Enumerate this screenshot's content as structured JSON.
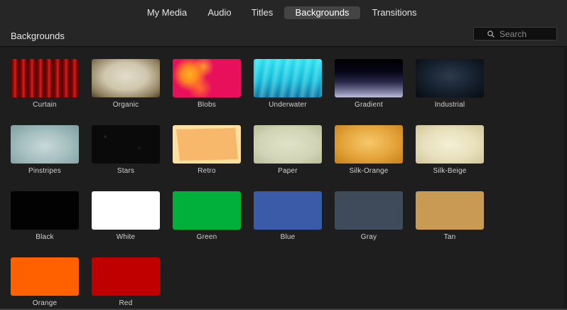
{
  "tabs": [
    {
      "label": "My Media",
      "active": false
    },
    {
      "label": "Audio",
      "active": false
    },
    {
      "label": "Titles",
      "active": false
    },
    {
      "label": "Backgrounds",
      "active": true
    },
    {
      "label": "Transitions",
      "active": false
    }
  ],
  "header": {
    "title": "Backgrounds",
    "search": {
      "placeholder": "Search",
      "value": "",
      "icon": "search-icon"
    }
  },
  "backgrounds": [
    {
      "label": "Curtain"
    },
    {
      "label": "Organic"
    },
    {
      "label": "Blobs"
    },
    {
      "label": "Underwater"
    },
    {
      "label": "Gradient"
    },
    {
      "label": "Industrial"
    },
    {
      "label": "Pinstripes"
    },
    {
      "label": "Stars"
    },
    {
      "label": "Retro"
    },
    {
      "label": "Paper"
    },
    {
      "label": "Silk-Orange"
    },
    {
      "label": "Silk-Beige"
    },
    {
      "label": "Black",
      "color": "#020202"
    },
    {
      "label": "White",
      "color": "#ffffff"
    },
    {
      "label": "Green",
      "color": "#00b03a"
    },
    {
      "label": "Blue",
      "color": "#3b5aa8"
    },
    {
      "label": "Gray",
      "color": "#3f4b5b"
    },
    {
      "label": "Tan",
      "color": "#c89a54"
    },
    {
      "label": "Orange",
      "color": "#ff6000"
    },
    {
      "label": "Red",
      "color": "#c00000"
    }
  ]
}
